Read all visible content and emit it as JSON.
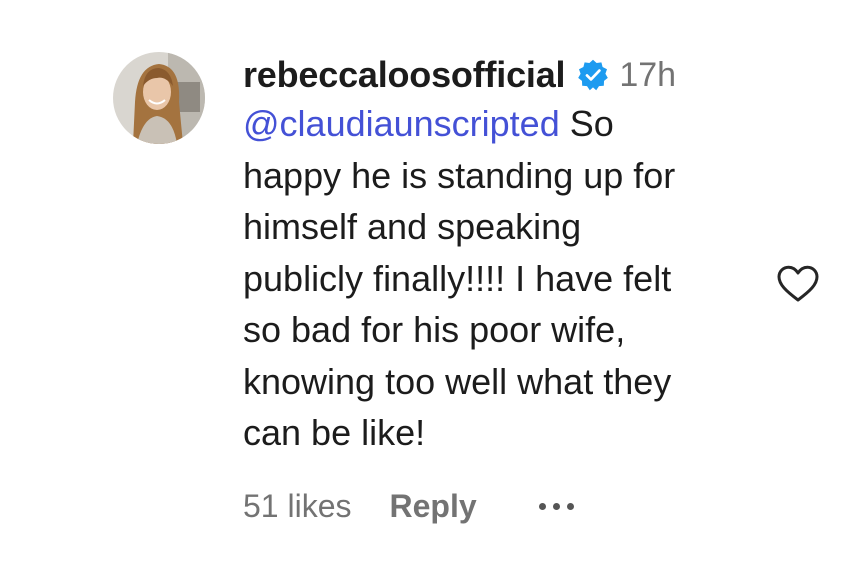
{
  "comment": {
    "username": "rebeccaloosofficial",
    "verified_icon": "verified-badge-icon",
    "timestamp": "17h",
    "mention": "@claudiaunscripted",
    "lines": [
      " So",
      "happy he is standing up for",
      "himself and speaking",
      "publicly finally!!!! I have felt",
      "so bad for his poor wife,",
      "knowing too well what they",
      "can be like!"
    ],
    "likes": "51 likes",
    "reply_label": "Reply",
    "more_icon": "more-options-icon",
    "like_icon": "heart-icon"
  },
  "colors": {
    "mention": "#4451d6",
    "verified": "#1d9bf0",
    "muted": "#737373",
    "text": "#1c1c1c"
  }
}
